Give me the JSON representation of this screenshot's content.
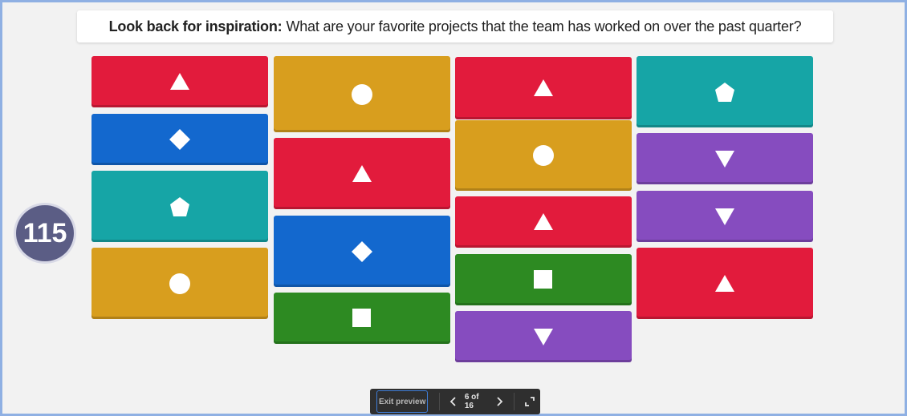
{
  "question": {
    "lead": "Look back for inspiration:",
    "text": "What are your favorite projects that the team has worked on over the past quarter?"
  },
  "timer": {
    "value": "115"
  },
  "colors": {
    "red": "#e21b3c",
    "blue": "#1368ce",
    "yellow": "#d89e1e",
    "green": "#2d8a22",
    "teal": "#16a5a6",
    "purple": "#864cbf"
  },
  "tiles": [
    {
      "column": 1,
      "color": "red",
      "shape": "triangle-icon"
    },
    {
      "column": 1,
      "color": "blue",
      "shape": "diamond-icon"
    },
    {
      "column": 1,
      "color": "teal",
      "shape": "pentagon-icon"
    },
    {
      "column": 1,
      "color": "yellow",
      "shape": "circle-icon"
    },
    {
      "column": 2,
      "color": "yellow",
      "shape": "circle-icon"
    },
    {
      "column": 2,
      "color": "red",
      "shape": "triangle-icon"
    },
    {
      "column": 2,
      "color": "blue",
      "shape": "diamond-icon"
    },
    {
      "column": 2,
      "color": "green",
      "shape": "square-icon"
    },
    {
      "column": 3,
      "color": "red",
      "shape": "triangle-icon"
    },
    {
      "column": 3,
      "color": "yellow",
      "shape": "circle-icon"
    },
    {
      "column": 3,
      "color": "red",
      "shape": "triangle-icon"
    },
    {
      "column": 3,
      "color": "green",
      "shape": "square-icon"
    },
    {
      "column": 3,
      "color": "purple",
      "shape": "down-triangle-icon"
    },
    {
      "column": 4,
      "color": "teal",
      "shape": "pentagon-icon"
    },
    {
      "column": 4,
      "color": "purple",
      "shape": "down-triangle-icon"
    },
    {
      "column": 4,
      "color": "purple",
      "shape": "down-triangle-icon"
    },
    {
      "column": 4,
      "color": "red",
      "shape": "triangle-icon"
    }
  ],
  "toolbar": {
    "exit_label": "Exit preview",
    "prev_icon": "chevron-left-icon",
    "page_label": "6 of 16",
    "next_icon": "chevron-right-icon",
    "fullscreen_icon": "fullscreen-icon"
  }
}
